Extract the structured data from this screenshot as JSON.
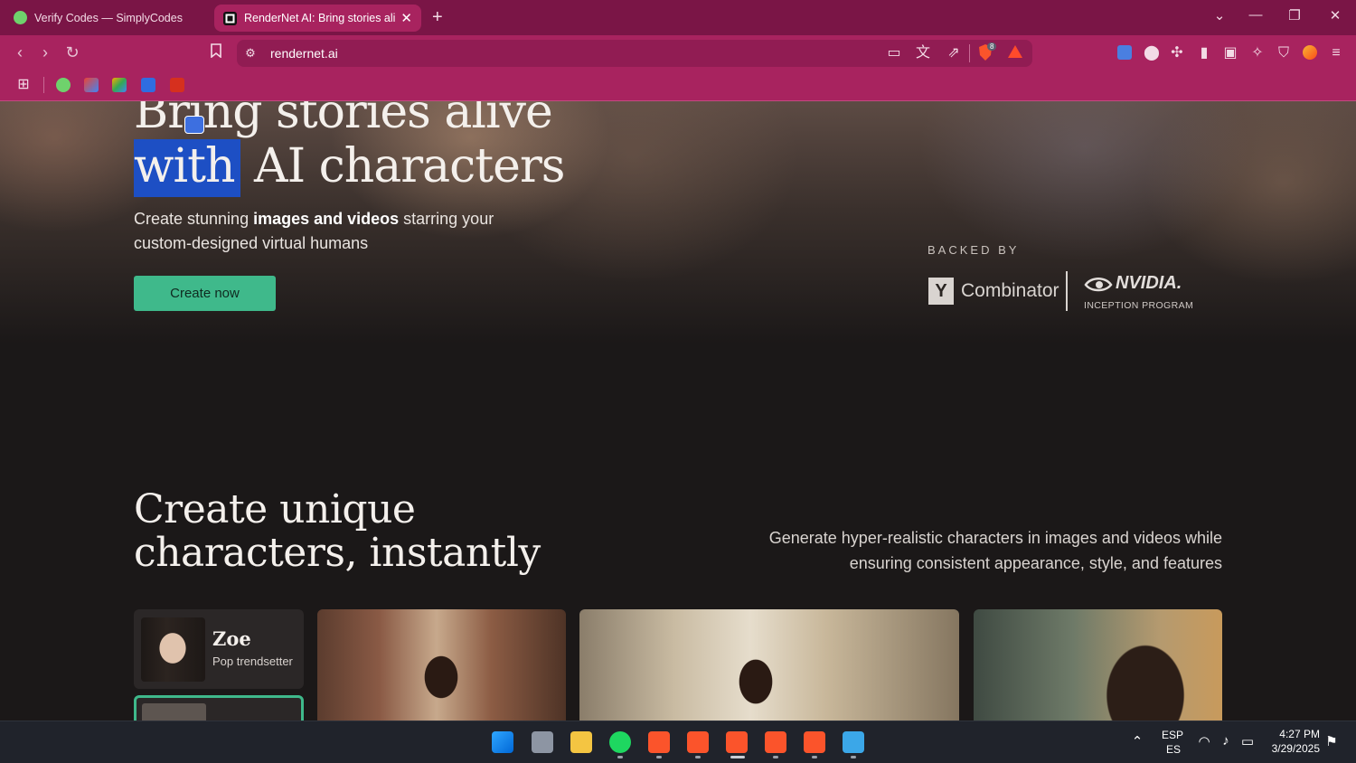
{
  "browser": {
    "tabs": [
      {
        "title": "Verify Codes — SimplyCodes",
        "active": false
      },
      {
        "title": "RenderNet AI: Bring stories alive",
        "active": true
      }
    ],
    "new_tab": "+",
    "url": "rendernet.ai",
    "shields_count": "8",
    "icons": {
      "back": "back-icon",
      "forward": "forward-icon",
      "reload": "reload-icon",
      "bookmark": "bookmark-icon",
      "site_info": "tune-icon"
    }
  },
  "hero": {
    "line1": "Bring stories alive",
    "line2_highlight": "with",
    "line2_rest": " AI characters",
    "sub_before": "Create stunning ",
    "sub_bold": "images and videos",
    "sub_after": " starring your custom-designed virtual humans",
    "cta": "Create now",
    "backed_by": "BACKED BY",
    "yc_letter": "Y",
    "yc_name": "Combinator",
    "nvidia_name": "NVIDIA.",
    "nvidia_sub": "INCEPTION PROGRAM"
  },
  "section": {
    "title_line1": "Create unique",
    "title_line2": "characters, instantly",
    "description": "Generate hyper-realistic characters in images and videos while ensuring consistent appearance, style, and features"
  },
  "characters": [
    {
      "name": "Zoe",
      "role": "Pop trendsetter"
    }
  ],
  "taskbar": {
    "lang_code": "ESP",
    "lang_region": "ES",
    "time": "4:27 PM",
    "date": "3/29/2025"
  },
  "colors": {
    "tabbar": "#7a1546",
    "toolbar": "#a8235f",
    "cta": "#3fb98b",
    "highlight": "#1d4fc4"
  }
}
